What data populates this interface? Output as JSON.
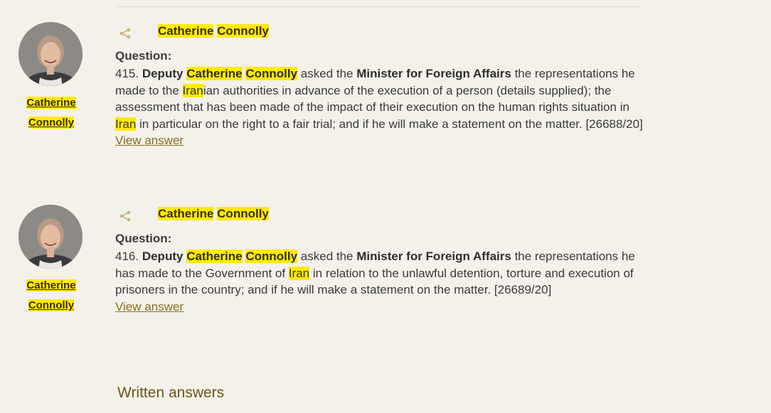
{
  "entries": [
    {
      "member_name_line1": "Catherine",
      "member_name_line2": "Connolly",
      "heading_first": "Catherine",
      "heading_last": "Connolly",
      "question_label": "Question:",
      "number": "415.",
      "deputy_word": "Deputy",
      "deputy_first": "Catherine",
      "deputy_last": "Connolly",
      "asked": "asked the",
      "minister": "Minister for Foreign Affairs",
      "text_a": "the representations he made to the",
      "hl_a": "Iran",
      "text_b": "ian authorities in advance of the execution of a person (details supplied); the assessment that has been made of the impact of their execution on the human rights situation in",
      "hl_b": "Iran",
      "text_c": "in particular on the right to a fair trial; and if he will make a statement on the matter. [26688/20]",
      "view_answer": "View answer"
    },
    {
      "member_name_line1": "Catherine",
      "member_name_line2": "Connolly",
      "heading_first": "Catherine",
      "heading_last": "Connolly",
      "question_label": "Question:",
      "number": "416.",
      "deputy_word": "Deputy",
      "deputy_first": "Catherine",
      "deputy_last": "Connolly",
      "asked": "asked the",
      "minister": "Minister for Foreign Affairs",
      "text_a": "the representations he has made to the Government of",
      "hl_a": "Iran",
      "text_b": "in relation to the unlawful detention, torture and execution of prisoners in the country; and if he will make a statement on the matter. [26689/20]",
      "view_answer": "View answer"
    }
  ],
  "section_heading": "Written answers",
  "colors": {
    "background": "#f4f1eb",
    "highlight": "#ffea00",
    "link": "#8a6d1f",
    "heading": "#6b5418"
  },
  "icons": {
    "share": "share-icon",
    "avatar": "member-avatar"
  }
}
